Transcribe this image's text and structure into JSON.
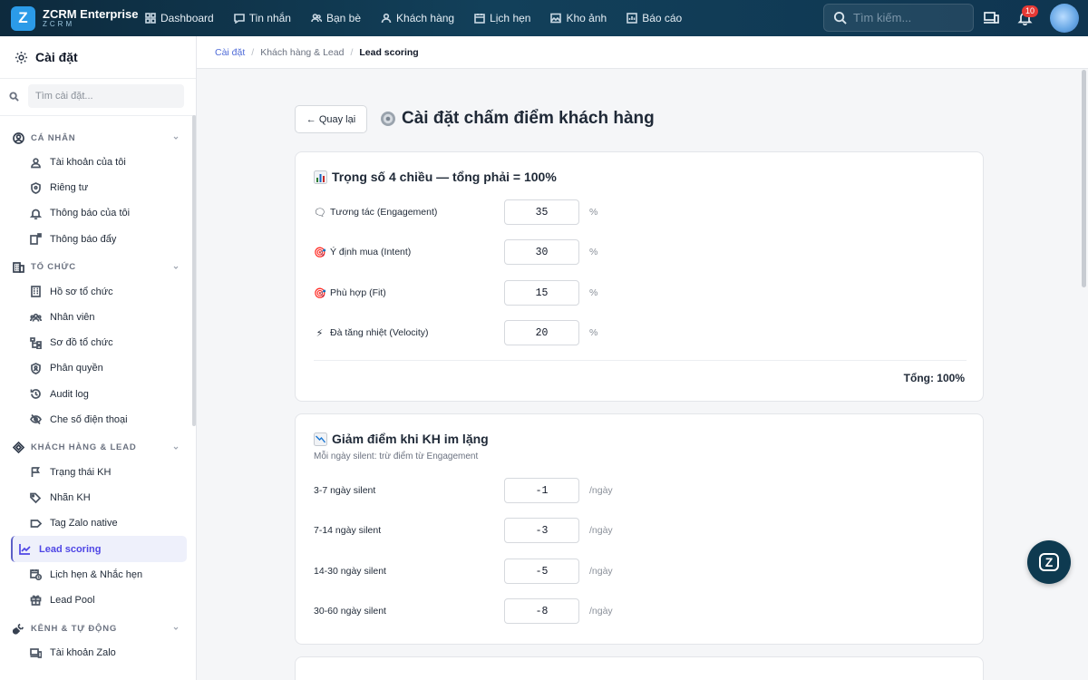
{
  "app": {
    "name": "ZCRM Enterprise",
    "sub": "ZCRM",
    "logo_letter": "Z"
  },
  "nav": [
    {
      "label": "Dashboard",
      "icon": "grid-icon"
    },
    {
      "label": "Tin nhắn",
      "icon": "chat-icon"
    },
    {
      "label": "Bạn bè",
      "icon": "users-icon"
    },
    {
      "label": "Khách hàng",
      "icon": "user-icon"
    },
    {
      "label": "Lịch hẹn",
      "icon": "calendar-icon"
    },
    {
      "label": "Kho ảnh",
      "icon": "image-icon"
    },
    {
      "label": "Báo cáo",
      "icon": "report-icon"
    }
  ],
  "topbar": {
    "search_placeholder": "Tìm kiếm...",
    "notifications_count": "10"
  },
  "sidebar": {
    "title": "Cài đặt",
    "search_placeholder": "Tìm cài đặt...",
    "groups": [
      {
        "label": "CÁ NHÂN",
        "items": [
          "Tài khoản của tôi",
          "Riêng tư",
          "Thông báo của tôi",
          "Thông báo đẩy"
        ]
      },
      {
        "label": "TỔ CHỨC",
        "items": [
          "Hồ sơ tổ chức",
          "Nhân viên",
          "Sơ đồ tổ chức",
          "Phân quyền",
          "Audit log",
          "Che số điện thoại"
        ]
      },
      {
        "label": "KHÁCH HÀNG & LEAD",
        "items": [
          "Trạng thái KH",
          "Nhãn KH",
          "Tag Zalo native",
          "Lead scoring",
          "Lịch hẹn & Nhắc hẹn",
          "Lead Pool"
        ]
      },
      {
        "label": "KÊNH & TỰ ĐỘNG",
        "items": [
          "Tài khoản Zalo"
        ]
      }
    ],
    "active_item": "Lead scoring"
  },
  "breadcrumb": {
    "root": "Cài đặt",
    "mid": "Khách hàng & Lead",
    "current": "Lead scoring"
  },
  "page": {
    "back_label": "← Quay lại",
    "title": "Cài đặt chấm điểm khách hàng"
  },
  "weights": {
    "title": "Trọng số 4 chiều — tổng phải = 100%",
    "rows": [
      {
        "emoji": "🗨",
        "label": "Tương tác (Engagement)",
        "value": "35",
        "unit": "%"
      },
      {
        "emoji": "🎯",
        "label": "Ý định mua (Intent)",
        "value": "30",
        "unit": "%"
      },
      {
        "emoji": "🎯",
        "label": "Phù hợp (Fit)",
        "value": "15",
        "unit": "%"
      },
      {
        "emoji": "⚡",
        "label": "Đà tăng nhiệt (Velocity)",
        "value": "20",
        "unit": "%"
      }
    ],
    "total": "Tổng: 100%"
  },
  "decay": {
    "title": "Giảm điểm khi KH im lặng",
    "subtitle": "Mỗi ngày silent: trừ điểm từ Engagement",
    "rows": [
      {
        "label": "3-7 ngày silent",
        "value": "-1",
        "unit": "/ngày"
      },
      {
        "label": "7-14 ngày silent",
        "value": "-3",
        "unit": "/ngày"
      },
      {
        "label": "14-30 ngày silent",
        "value": "-5",
        "unit": "/ngày"
      },
      {
        "label": "30-60 ngày silent",
        "value": "-8",
        "unit": "/ngày"
      }
    ]
  },
  "colors": {
    "topbar": "#0d2a3d",
    "accent": "#4f46e5",
    "link": "#4f6bd8",
    "fab": "#0e3a50",
    "badge": "#e53935"
  }
}
